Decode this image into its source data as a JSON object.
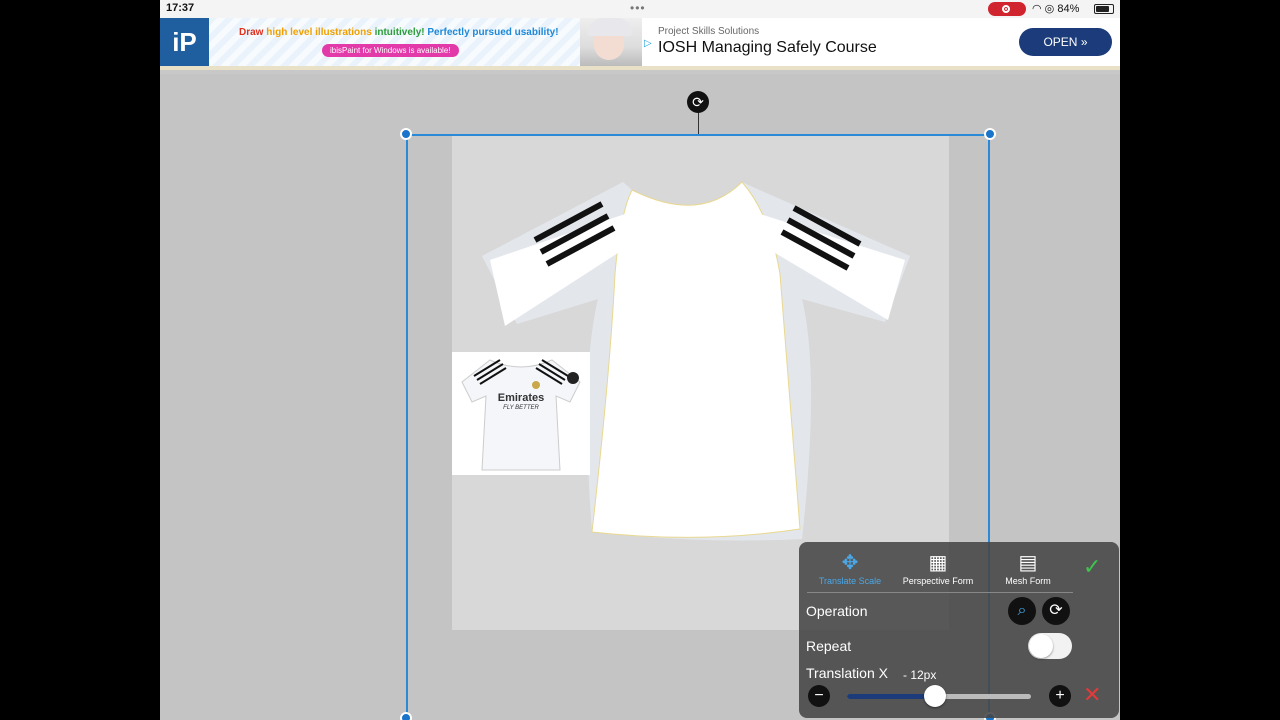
{
  "status_bar": {
    "time": "17:37",
    "battery": "84%",
    "battery_level": 0.84
  },
  "ad": {
    "line1_parts": [
      "Draw ",
      "high level illustrations ",
      "intuitively! ",
      "Perfectly pursued usability!"
    ],
    "pill": "ibisPaint for Windows is available!",
    "sponsor": "Project Skills Solutions",
    "title": "IOSH Managing Safely Course",
    "open_label": "OPEN",
    "open_icon": "double-chevron-right-icon"
  },
  "reference_photo": {
    "brand": "Emirates",
    "tagline": "FLY BETTER"
  },
  "panel": {
    "tools": [
      {
        "label": "Translate Scale",
        "icon": "move-arrows-icon",
        "active": true
      },
      {
        "label": "Perspective Form",
        "icon": "perspective-grid-icon",
        "active": false
      },
      {
        "label": "Mesh Form",
        "icon": "mesh-map-icon",
        "active": false
      }
    ],
    "operation_label": "Operation",
    "repeat_label": "Repeat",
    "repeat_on": false,
    "translation_label": "Translation X",
    "translation_value": "- 12px",
    "slider_level": 0.48
  },
  "colors": {
    "accent": "#2b8ad8",
    "confirm": "#3fc34f",
    "cancel": "#e23a3a",
    "ad_button": "#1b3b7a"
  }
}
